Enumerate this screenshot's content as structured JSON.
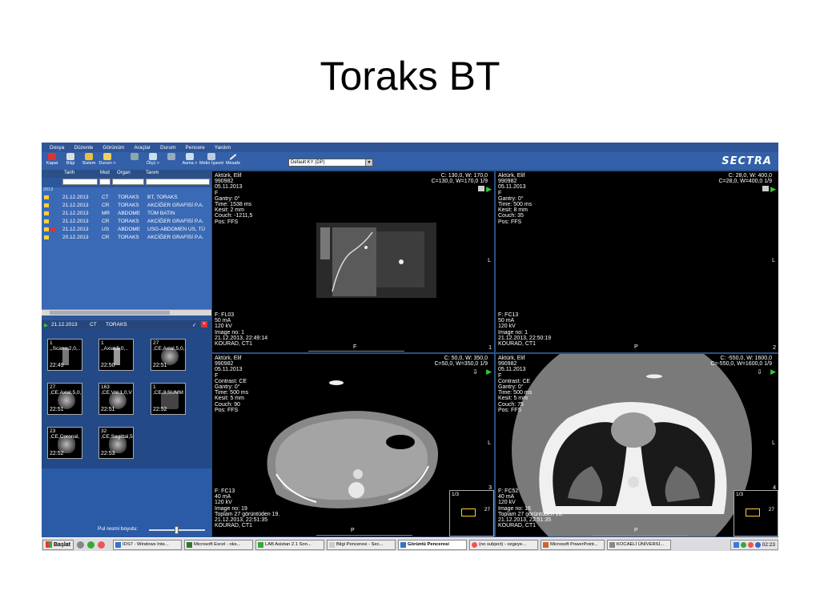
{
  "slide": {
    "title": "Toraks BT"
  },
  "menu": [
    "Dosya",
    "Düzenle",
    "Görünüm",
    "Araçlar",
    "Durum",
    "Pencere",
    "Yardım"
  ],
  "toolbar": {
    "buttons": [
      "Kapat",
      "Bilgi",
      "Sistem",
      "Durum >",
      "",
      "Ölçü >",
      "",
      "Asma >",
      "Metin İşareti",
      "Mesafe"
    ],
    "select_value": "Default KY (DP)",
    "logo": "SECTRA"
  },
  "list": {
    "headers": {
      "date": "Tarih",
      "mod": "Mod",
      "organ": "Organ",
      "desc": "Tanım"
    },
    "year_label": "2013",
    "rows": [
      {
        "date": "21.12.2013",
        "mod": "CT",
        "organ": "TORAKS",
        "desc": "BT, TORAKS"
      },
      {
        "date": "21.12.2013",
        "mod": "CR",
        "organ": "TORAKS",
        "desc": "AKCİĞER GRAFİSİ P.A."
      },
      {
        "date": "21.12.2013",
        "mod": "MR",
        "organ": "ABDOME",
        "desc": "TÜM BATIN"
      },
      {
        "date": "21.12.2013",
        "mod": "CR",
        "organ": "TORAKS",
        "desc": "AKCİĞER GRAFİSİ P.A."
      },
      {
        "date": "21.12.2013",
        "mod": "US",
        "organ": "ABDOME",
        "desc": "USG-ABDOMEN US, TÜ"
      },
      {
        "date": "20.12.2013",
        "mod": "CR",
        "organ": "TORAKS",
        "desc": "AKCİĞER GRAFİSİ P.A."
      }
    ]
  },
  "series_header": {
    "date": "21.12.2013",
    "mod": "CT",
    "organ": "TORAKS"
  },
  "thumbnails": [
    {
      "num": "1",
      "name": ",,Scano,2,0,..",
      "time": "22:49"
    },
    {
      "num": "1",
      "name": ",,Axial,5,0,..",
      "time": "22:50"
    },
    {
      "num": "27",
      "name": ",CE,Axial,5,0,",
      "time": "22:51"
    },
    {
      "num": "27",
      "name": ",CE,Axial,5,0,",
      "time": "22:51"
    },
    {
      "num": "163",
      "name": ",CE,Vol,1,0,V",
      "time": "22:51"
    },
    {
      "num": "1",
      "name": ",CE,3,SUMM",
      "time": "22:52"
    },
    {
      "num": "23",
      "name": ",CE,Coronal,",
      "time": "22:52"
    },
    {
      "num": "32",
      "name": ",CE,Sagittal,5",
      "time": "22:53"
    }
  ],
  "size_label": "Pul resmi boyutu:",
  "viewports": [
    {
      "tl": "Aktürk, Elif\n990982\n05.11.2013\nF\nGantry: 0°\nTime: 1538 ms\nKesit: 2 mm\nCouch: -1211,5\nPos: FFS",
      "tr": "C: 130,0, W: 170,0\nC=130,0, W=170,0 1/9",
      "bl": "F: FL03\n50 mA\n120 kV\nImage no: 1\n21.12.2013, 22:49:14\nKOURAD, CT1",
      "side": "L",
      "bottom": "F",
      "corner": "1"
    },
    {
      "tl": "Aktürk, Elif\n990982\n05.11.2013\nF\nGantry: 0°\nTime: 500 ms\nKesit: 8 mm\nCouch: 35\nPos: FFS",
      "tr": "C: 28,0, W: 400,0\nC=28,0, W=400,0 1/9",
      "bl": "F: FC13\n50 mA\n120 kV\nImage no: 1\n21.12.2013, 22:50:19\nKOURAD, CT1",
      "side": "L",
      "bottom": "P",
      "corner": "2"
    },
    {
      "tl": "Aktürk, Elif\n990982\n05.11.2013\nF\nContrast: CE\nGantry: 0°\nTime: 500 ms\nKesit: 5 mm\nCouch: 90\nPos: FFS",
      "tr": "C: 50,0, W: 350,0\nC=50,0, W=350,0 1/9",
      "bl": "F: FC13\n40 mA\n120 kV\nImage no: 19\nToplam 27 görüntüden 19.\n21.12.2013, 22:51:35\nKOURAD, CT1",
      "side": "L",
      "bottom": "P",
      "corner": "3",
      "stack": "1/3",
      "stack_n": "27"
    },
    {
      "tl": "Aktürk, Elif\n990982\n05.11.2013\nF\nContrast: CE\nGantry: 0°\nTime: 500 ms\nKesit: 5 mm\nCouch: 75\nPos: FFS",
      "tr": "C: -550,0, W: 1600,0\nC=-550,0, W=1600,0 1/9",
      "bl": "F: FC52\n40 mA\n120 kV\nImage no: 16\nToplam 27 görüntüden 16.\n21.12.2013, 22:51:35\nKOURAD, CT1",
      "side": "L",
      "bottom": "P",
      "corner": "4",
      "stack": "1/3",
      "stack_n": "27"
    }
  ],
  "taskbar": {
    "start": "Başlat",
    "tasks": [
      "IDS7 - Windows Inte...",
      "Microsoft Excel - oks...",
      "LAB Asistan 2.1 Son...",
      "Bilgi Penceresi - Sec...",
      "Görüntü Penceresi",
      "(no subject) - ozgeye...",
      "Microsoft PowerPoint...",
      "KOCAELİ ÜNİVERSİ..."
    ],
    "active_task": 4,
    "clock": "02:23"
  },
  "colors": {
    "app_bg": "#2b4f87",
    "list_bg": "#3a69b5",
    "viewport_bg": "#000000",
    "folder": "#ffd23f",
    "play": "#33cc33"
  }
}
